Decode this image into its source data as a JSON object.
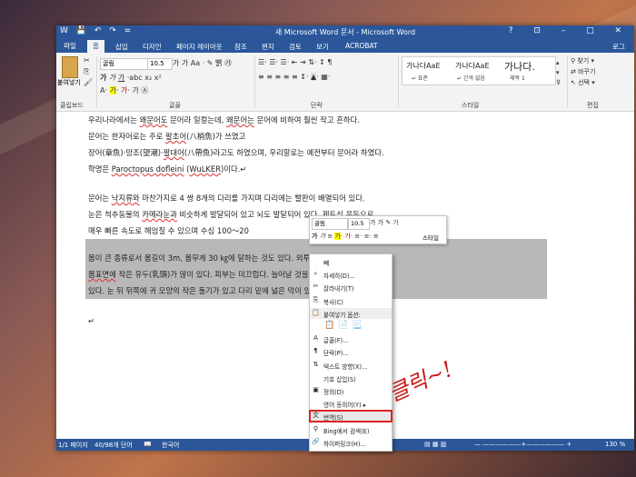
{
  "window": {
    "title": "새 Microsoft Word 문서 - Microsoft Word",
    "controls": [
      "?",
      "⊡",
      "–",
      "□",
      "✕"
    ],
    "quick_access": [
      "W",
      "💾",
      "↶",
      "↷",
      "="
    ]
  },
  "tabs": [
    {
      "label": "파일"
    },
    {
      "label": "홈"
    },
    {
      "label": "삽입"
    },
    {
      "label": "디자인"
    },
    {
      "label": "페이지 레이아웃"
    },
    {
      "label": "참조"
    },
    {
      "label": "편지"
    },
    {
      "label": "검토"
    },
    {
      "label": "보기"
    },
    {
      "label": "ACROBAT"
    }
  ],
  "account": "로그",
  "ribbon": {
    "clipboard": {
      "paste": "붙여넣기",
      "label": "클립보드"
    },
    "font": {
      "name": "굴림",
      "size": "10.5",
      "label": "글꼴"
    },
    "paragraph": {
      "label": "단락"
    },
    "styles": {
      "label": "스타일",
      "items": [
        {
          "preview": "가나다AaE",
          "name": "↵ 표준"
        },
        {
          "preview": "가나다AaE",
          "name": "↵ 간격 없음"
        },
        {
          "preview": "가나다.",
          "name": "제목 1"
        }
      ]
    },
    "editing": {
      "find": "찾기 ▾",
      "replace": "바꾸기",
      "select": "선택 ▾",
      "label": "편집"
    }
  },
  "document": {
    "lines": [
      [
        "우리나라에서는 ",
        "왜문어도",
        " 문어라 일컬는데, ",
        "왜문어는",
        " 문어에 비하여 훨씬 작고 흔하다."
      ],
      [
        "문어는 한자어로는 주로 ",
        "팔초어",
        "(八梢魚)가 쓰였고"
      ],
      [
        "장어(章魚)·망조(望潮)·",
        "팔대어",
        "(八帶魚)라고도 하였으며, 우리말로는 예전부터 문어라 하였다."
      ],
      [
        "학명은 ",
        "Paroctopus dofleini",
        " (",
        "WuLKER",
        ")이다.↵"
      ],
      [
        "문어는 ",
        "낙지류와",
        " 마찬가지로 4 쌍 8개의 다리를 가지며 다리에는 빨판이 배열되어 있다."
      ],
      [
        "눈은 척추동물의 ",
        "카메라눈과",
        " 비슷하게 발달되어 있고 뇌도 발달되어 있다. ",
        "제트식",
        " 운동으로"
      ],
      [
        "매우 빠른 속도로 헤엄칠 수 있으며 수심 100～20"
      ],
      [
        "몸이 큰 종류로서 몸길이 3m, 몸무게 30 ㎏에 달하는 것도 있다. 외투는 짧은 난형이며"
      ],
      [
        "",
        "몸표면에",
        " 작은 유두(乳頭)가 많이 있다. 피부는 미끄럽다. 늘어날 것을 때는 가는 주름살이"
      ],
      [
        "있다. 눈 뒤 뒤쪽에 귀 모양의 작은 돌기가 있고 다리 밑에 넓은 막이 있다.↵"
      ],
      [
        "↵"
      ]
    ]
  },
  "mini_toolbar": {
    "font": "굴림",
    "size": "10.5",
    "row1_icons": [
      "가",
      "가",
      "✎",
      "가"
    ],
    "row2_icons": [
      "가",
      "가",
      "≡",
      "가",
      "가",
      "≡",
      "≡",
      "≡"
    ],
    "style_label": "스타일"
  },
  "context_menu": {
    "items": [
      {
        "label": "빼",
        "icon": "",
        "name": "ctx-item-truncated"
      },
      {
        "label": "자세히(D)...",
        "icon": "⌕",
        "name": "ctx-item-more"
      },
      {
        "label": "잘라내기(T)",
        "icon": "✂",
        "name": "ctx-item-cut"
      },
      {
        "label": "복사(C)",
        "icon": "⎘",
        "name": "ctx-item-copy"
      },
      {
        "label": "붙여넣기 옵션:",
        "icon": "📋",
        "name": "ctx-item-paste-options"
      },
      {
        "label": "",
        "icon": "",
        "name": "ctx-item-paste-icons"
      },
      {
        "label": "글꼴(F)...",
        "icon": "A",
        "name": "ctx-item-font"
      },
      {
        "label": "단락(P)...",
        "icon": "¶",
        "name": "ctx-item-paragraph"
      },
      {
        "label": "텍스트 방향(X)...",
        "icon": "⇅",
        "name": "ctx-item-text-direction"
      },
      {
        "label": "기호 삽입(S)",
        "icon": "",
        "name": "ctx-item-insert-symbol"
      },
      {
        "label": "정의(D)",
        "icon": "▣",
        "name": "ctx-item-define"
      },
      {
        "label": "영어 동의어(Y)   ▸",
        "icon": "",
        "name": "ctx-item-synonyms"
      },
      {
        "label": "번역(S)",
        "icon": "文",
        "name": "ctx-item-translate"
      },
      {
        "label": "Bing에서 검색(E)",
        "icon": "⚲",
        "name": "ctx-item-bing-search"
      },
      {
        "label": "하이퍼링크(H)...",
        "icon": "🔗",
        "name": "ctx-item-hyperlink"
      }
    ],
    "selected_index": 12
  },
  "statusbar": {
    "page": "1/1 페이지",
    "words": "40/98개 단어",
    "language": "한국어",
    "zoom": "130 %"
  },
  "annotation": "클릭~!",
  "colors": {
    "word_blue": "#2b579a",
    "highlight_red": "#d22222"
  }
}
